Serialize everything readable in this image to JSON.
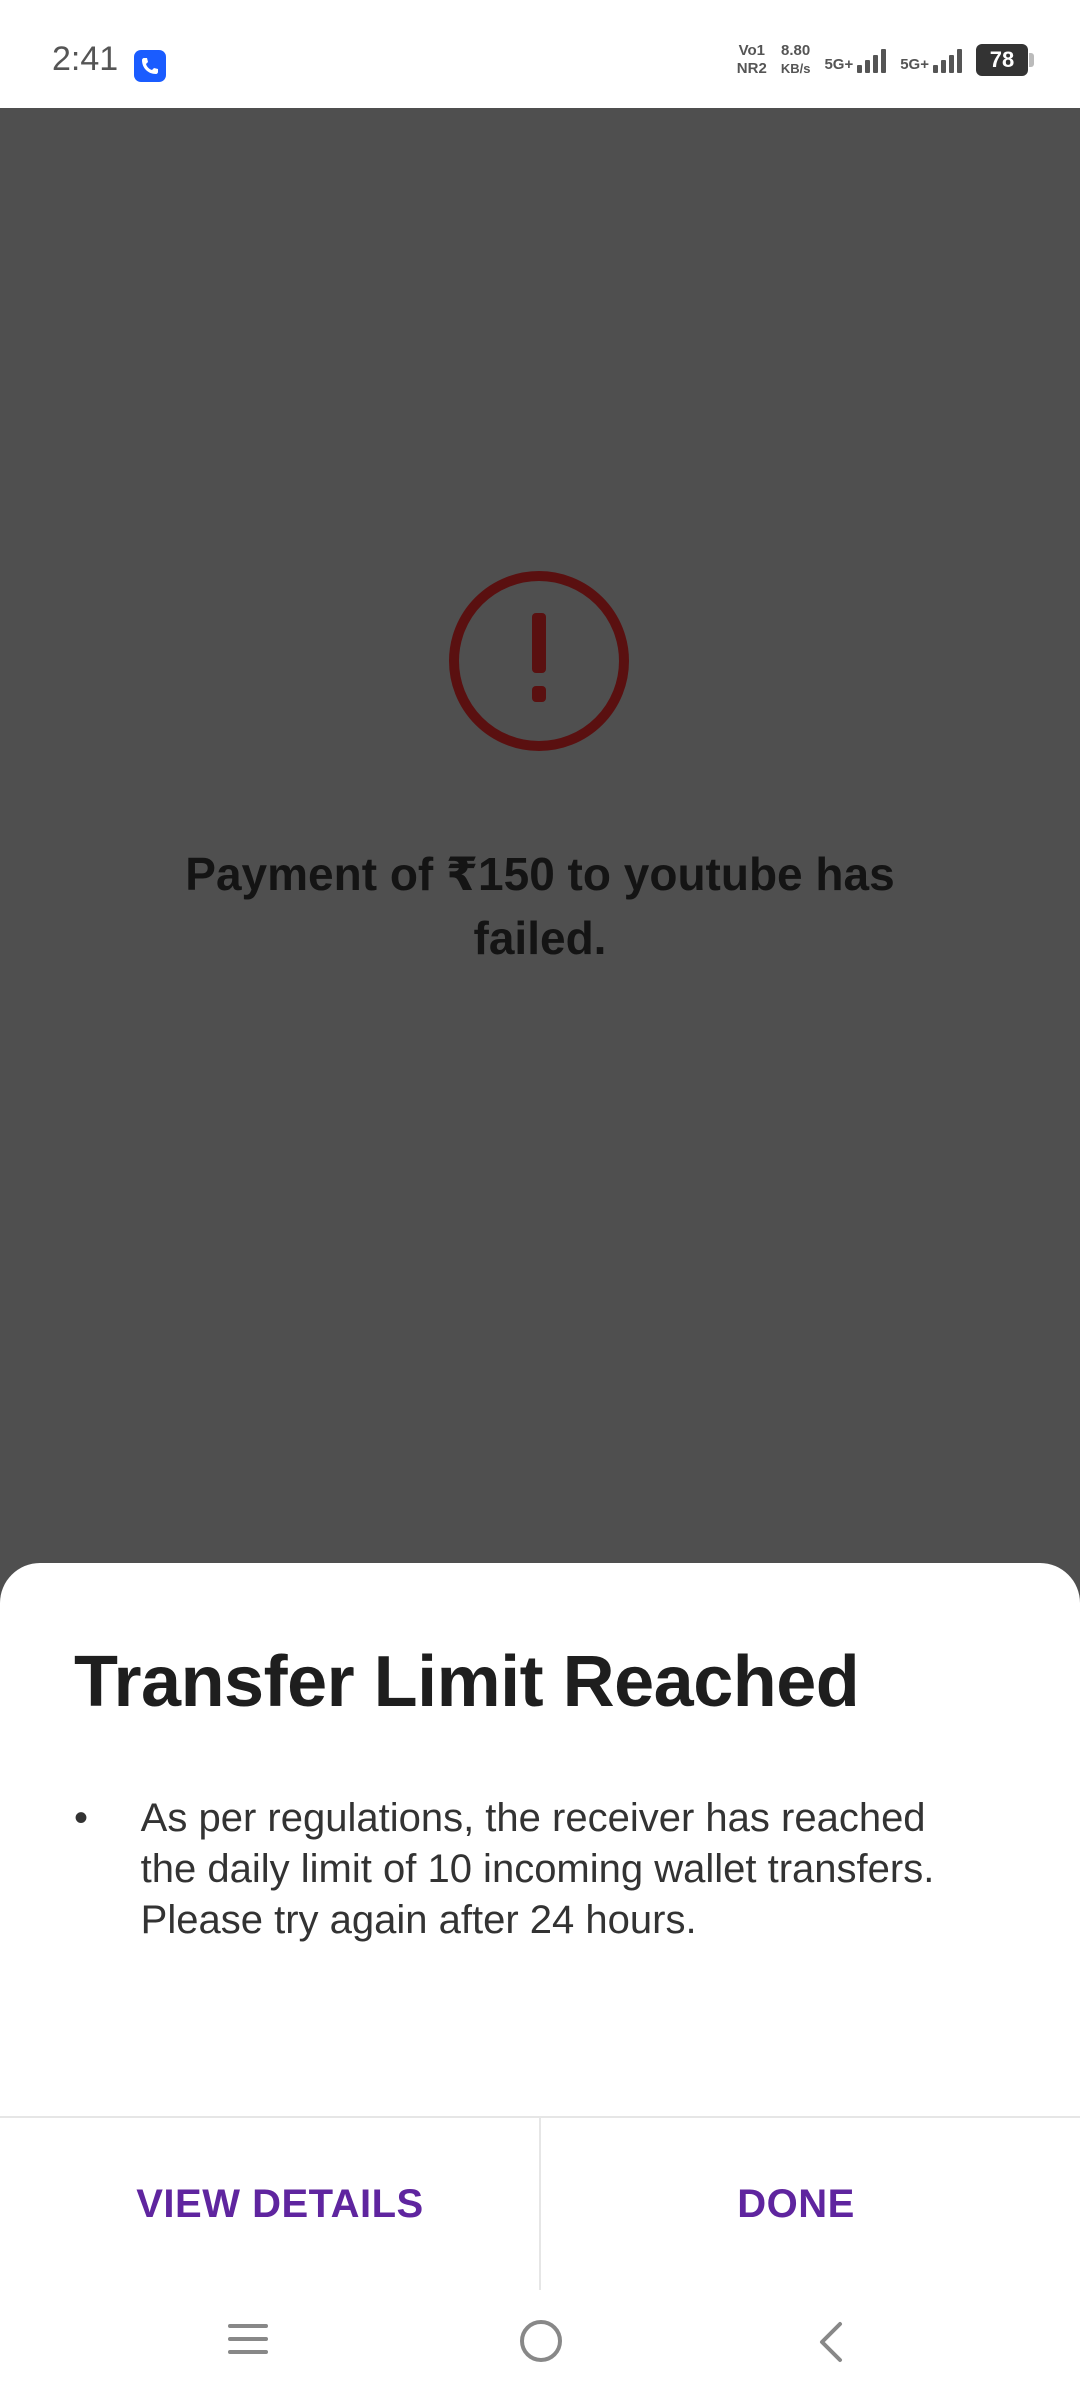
{
  "status_bar": {
    "time": "2:41",
    "sim1_top": "Vo1",
    "sim1_bottom": "NR2",
    "speed_value": "8.80",
    "speed_unit": "KB/s",
    "net1": "5G+",
    "net2": "5G+",
    "battery": "78"
  },
  "background_page": {
    "failure_message": "Payment of ₹150 to youtube has failed."
  },
  "sheet": {
    "title": "Transfer Limit Reached",
    "bullets": [
      "As per regulations, the receiver has reached the daily limit of 10 incoming wallet transfers. Please try again after 24 hours."
    ],
    "view_details_label": "VIEW DETAILS",
    "done_label": "DONE"
  },
  "colors": {
    "accent": "#5f259f",
    "overlay": "#4f4f4f",
    "error_icon": "#5a1010"
  }
}
